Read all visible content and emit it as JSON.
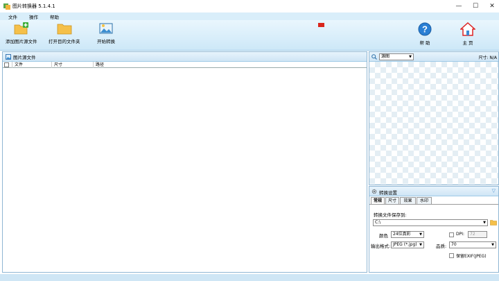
{
  "window": {
    "title": "图片转换器 5.1.4.1",
    "minimize": "—",
    "maximize": "☐",
    "close": "✕"
  },
  "menu": [
    {
      "label": "文件"
    },
    {
      "label": "操作"
    },
    {
      "label": "帮助"
    }
  ],
  "toolbar": {
    "add_source": "添加图片源文件",
    "open_target": "打开目的文件夹",
    "start": "开始转换",
    "help": "帮 助",
    "home": "主 页"
  },
  "source_panel": {
    "title": "图片源文件",
    "columns": [
      "文件",
      "尺寸",
      "路径"
    ]
  },
  "preview": {
    "mode": "源图",
    "size_label": "尺寸: N/A"
  },
  "settings": {
    "title": "转换设置",
    "tabs": [
      "常规",
      "尺寸",
      "效果",
      "水印"
    ],
    "save_to_label": "转换文件保存到:",
    "save_path": "C:\\",
    "color_label": "颜色",
    "color_value": "24位真彩",
    "dpi_label": "DPI:",
    "dpi_value": "72",
    "format_label": "输出格式:",
    "format_value": "JPEG (*.jpg)",
    "quality_label": "品质:",
    "quality_value": "70",
    "exif_label": "保留EXIF(JPEG)"
  },
  "colors": {
    "accent": "#cde8f8",
    "border": "#8fb6d3",
    "flag": "#d9261c"
  }
}
